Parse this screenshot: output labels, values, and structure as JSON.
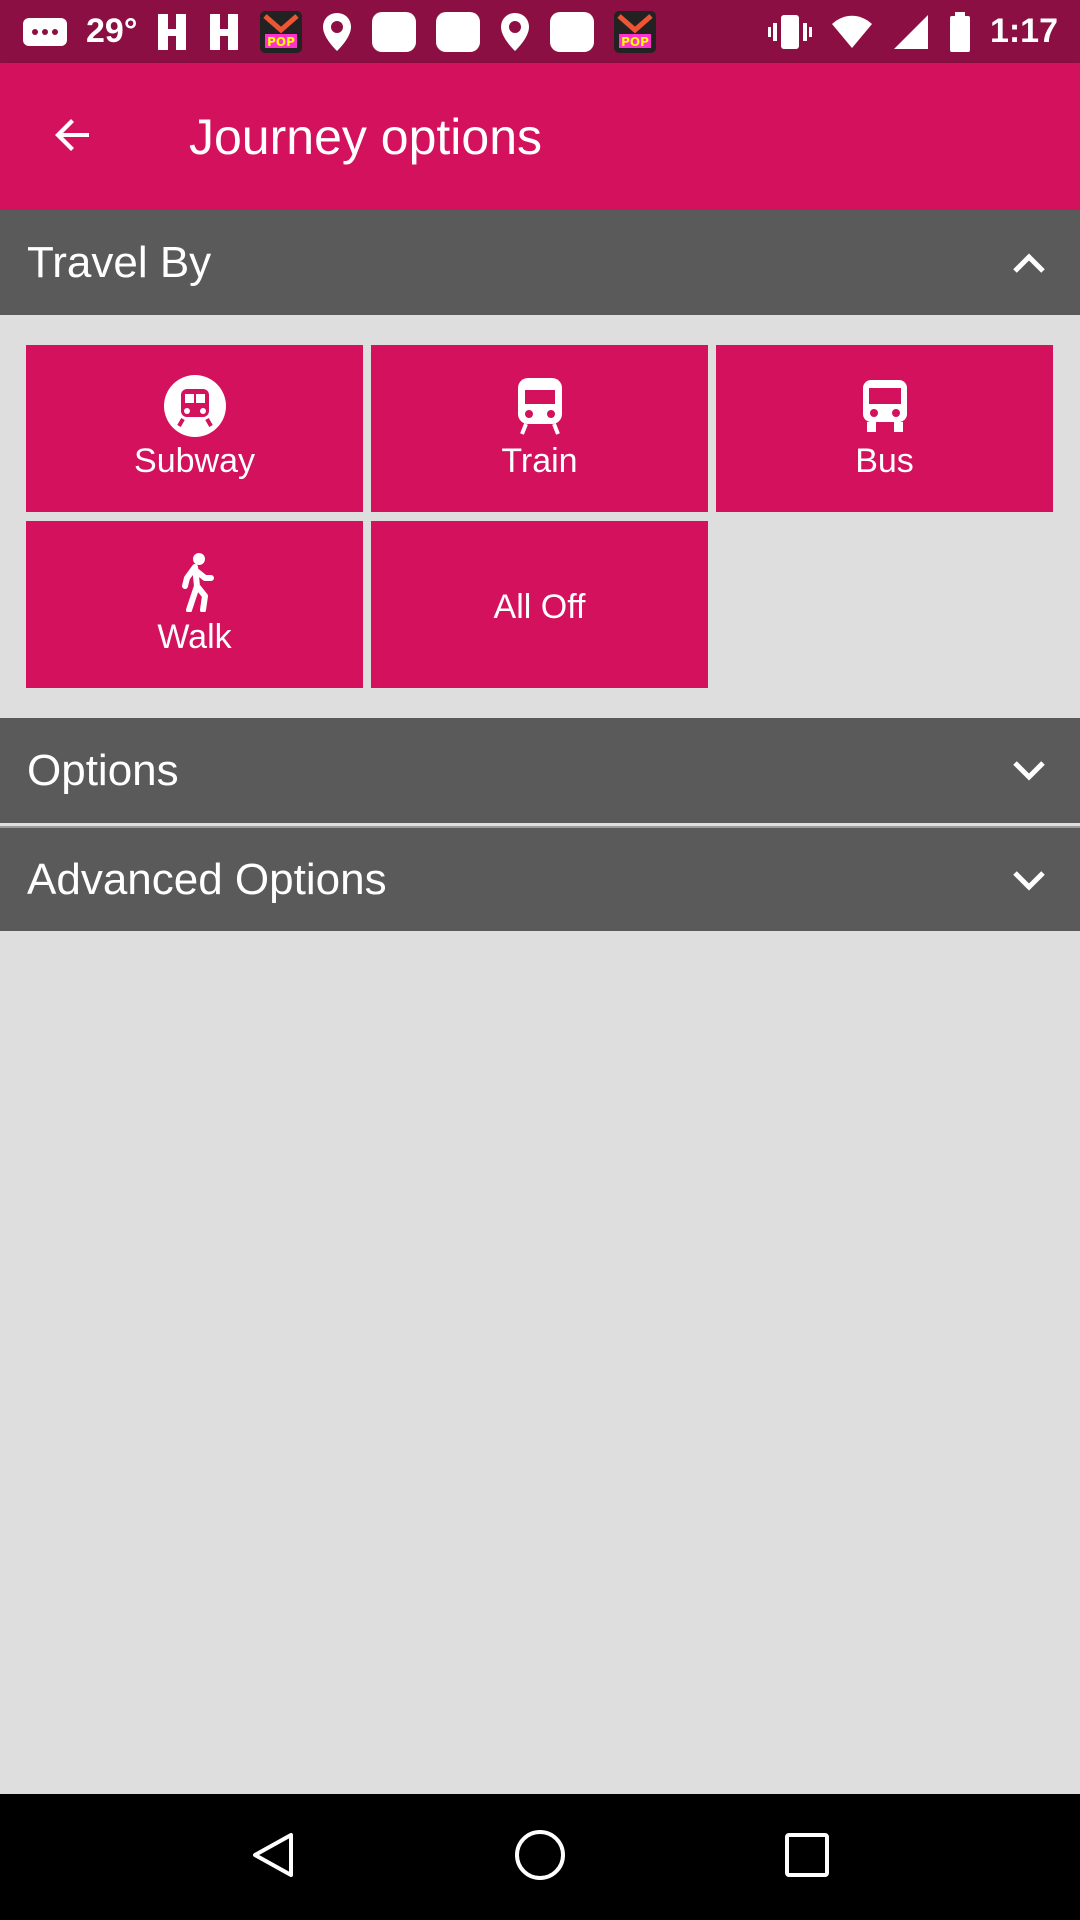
{
  "status_bar": {
    "temperature": "29°",
    "time": "1:17"
  },
  "app_bar": {
    "title": "Journey options"
  },
  "sections": {
    "travel_by": "Travel By",
    "options": "Options",
    "advanced_options": "Advanced Options"
  },
  "modes": [
    {
      "label": "Subway",
      "icon": "subway-icon"
    },
    {
      "label": "Train",
      "icon": "train-icon"
    },
    {
      "label": "Bus",
      "icon": "bus-icon"
    },
    {
      "label": "Walk",
      "icon": "walk-icon"
    },
    {
      "label": "All Off"
    }
  ],
  "colors": {
    "primary": "#d3115d",
    "status_bar": "#8c0f43",
    "section_header": "#5a5a5a",
    "background": "#dedede"
  }
}
